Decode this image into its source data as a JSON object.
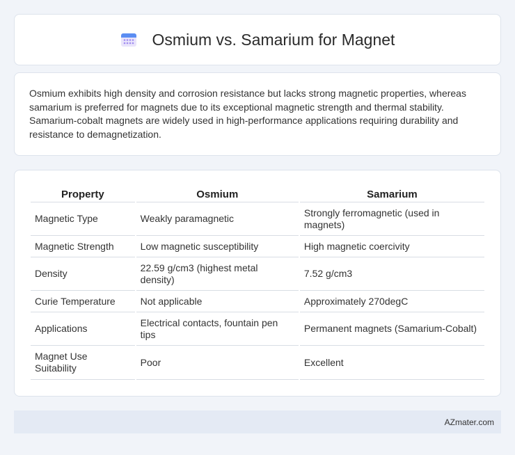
{
  "header": {
    "title": "Osmium vs. Samarium for Magnet",
    "icon": "calendar-icon"
  },
  "intro": {
    "text": "Osmium exhibits high density and corrosion resistance but lacks strong magnetic properties, whereas samarium is preferred for magnets due to its exceptional magnetic strength and thermal stability. Samarium-cobalt magnets are widely used in high-performance applications requiring durability and resistance to demagnetization."
  },
  "table": {
    "headers": [
      "Property",
      "Osmium",
      "Samarium"
    ],
    "rows": [
      [
        "Magnetic Type",
        "Weakly paramagnetic",
        "Strongly ferromagnetic (used in magnets)"
      ],
      [
        "Magnetic Strength",
        "Low magnetic susceptibility",
        "High magnetic coercivity"
      ],
      [
        "Density",
        "22.59 g/cm3 (highest metal density)",
        "7.52 g/cm3"
      ],
      [
        "Curie Temperature",
        "Not applicable",
        "Approximately 270degC"
      ],
      [
        "Applications",
        "Electrical contacts, fountain pen tips",
        "Permanent magnets (Samarium-Cobalt)"
      ],
      [
        "Magnet Use Suitability",
        "Poor",
        "Excellent"
      ]
    ]
  },
  "footer": {
    "brand": "AZmater.com"
  },
  "colors": {
    "background": "#f1f4f9",
    "card": "#ffffff",
    "footer": "#e4eaf4",
    "icon_accent": "#7b6cf0"
  }
}
